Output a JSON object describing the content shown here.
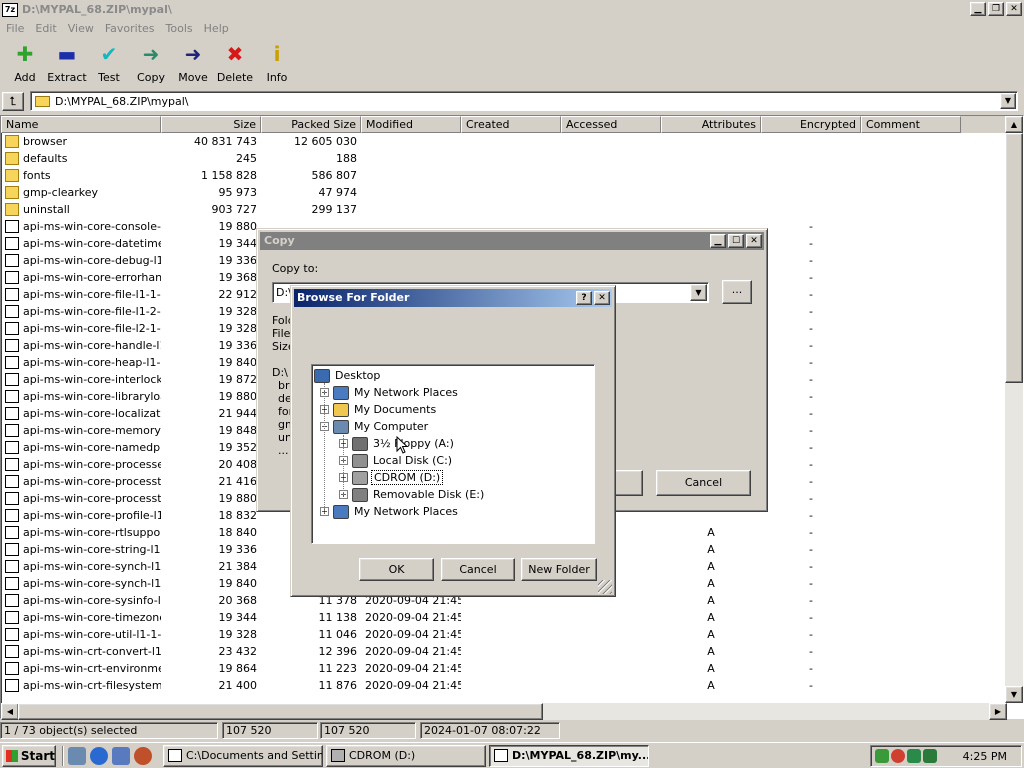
{
  "window": {
    "title": "D:\\MYPAL_68.ZIP\\mypal\\"
  },
  "menu": [
    "File",
    "Edit",
    "View",
    "Favorites",
    "Tools",
    "Help"
  ],
  "toolbar": [
    {
      "label": "Add",
      "icon": "add-icon",
      "glyph": "✚",
      "color": "#2ea42e"
    },
    {
      "label": "Extract",
      "icon": "extract-icon",
      "glyph": "▬",
      "color": "#1c2fa8"
    },
    {
      "label": "Test",
      "icon": "test-icon",
      "glyph": "✔",
      "color": "#16b6c0"
    },
    {
      "label": "Copy",
      "icon": "copy-icon",
      "glyph": "➜",
      "color": "#2a8a6a"
    },
    {
      "label": "Move",
      "icon": "move-icon",
      "glyph": "➜",
      "color": "#1c2480"
    },
    {
      "label": "Delete",
      "icon": "delete-icon",
      "glyph": "✖",
      "color": "#d81818"
    },
    {
      "label": "Info",
      "icon": "info-icon",
      "glyph": "i",
      "color": "#c8a000"
    }
  ],
  "address": {
    "path": "D:\\MYPAL_68.ZIP\\mypal\\"
  },
  "columns": [
    "Name",
    "Size",
    "Packed Size",
    "Modified",
    "Created",
    "Accessed",
    "Attributes",
    "Encrypted",
    "Comment"
  ],
  "rows": [
    {
      "type": "folder",
      "name": "browser",
      "size": "40 831 743",
      "packed": "12 605 030",
      "modified": "",
      "attr": "",
      "enc": ""
    },
    {
      "type": "folder",
      "name": "defaults",
      "size": "245",
      "packed": "188",
      "modified": "",
      "attr": "",
      "enc": ""
    },
    {
      "type": "folder",
      "name": "fonts",
      "size": "1 158 828",
      "packed": "586 807",
      "modified": "",
      "attr": "",
      "enc": ""
    },
    {
      "type": "folder",
      "name": "gmp-clearkey",
      "size": "95 973",
      "packed": "47 974",
      "modified": "",
      "attr": "",
      "enc": ""
    },
    {
      "type": "folder",
      "name": "uninstall",
      "size": "903 727",
      "packed": "299 137",
      "modified": "",
      "attr": "",
      "enc": ""
    },
    {
      "type": "file",
      "name": "api-ms-win-core-console-l...",
      "size": "19 880",
      "packed": "",
      "modified": "",
      "attr": "",
      "enc": "-"
    },
    {
      "type": "file",
      "name": "api-ms-win-core-datetime-...",
      "size": "19 344",
      "packed": "",
      "modified": "",
      "attr": "",
      "enc": "-"
    },
    {
      "type": "file",
      "name": "api-ms-win-core-debug-l1-...",
      "size": "19 336",
      "packed": "",
      "modified": "",
      "attr": "",
      "enc": "-"
    },
    {
      "type": "file",
      "name": "api-ms-win-core-errorhan...",
      "size": "19 368",
      "packed": "",
      "modified": "",
      "attr": "",
      "enc": "-"
    },
    {
      "type": "file",
      "name": "api-ms-win-core-file-l1-1-0...",
      "size": "22 912",
      "packed": "",
      "modified": "",
      "attr": "",
      "enc": "-"
    },
    {
      "type": "file",
      "name": "api-ms-win-core-file-l1-2-0...",
      "size": "19 328",
      "packed": "",
      "modified": "",
      "attr": "",
      "enc": "-"
    },
    {
      "type": "file",
      "name": "api-ms-win-core-file-l2-1-0...",
      "size": "19 328",
      "packed": "",
      "modified": "",
      "attr": "",
      "enc": "-"
    },
    {
      "type": "file",
      "name": "api-ms-win-core-handle-l1...",
      "size": "19 336",
      "packed": "",
      "modified": "",
      "attr": "",
      "enc": "-"
    },
    {
      "type": "file",
      "name": "api-ms-win-core-heap-l1-1...",
      "size": "19 840",
      "packed": "",
      "modified": "",
      "attr": "",
      "enc": "-"
    },
    {
      "type": "file",
      "name": "api-ms-win-core-interlocke...",
      "size": "19 872",
      "packed": "",
      "modified": "",
      "attr": "",
      "enc": "-"
    },
    {
      "type": "file",
      "name": "api-ms-win-core-libraryloa...",
      "size": "19 880",
      "packed": "",
      "modified": "",
      "attr": "",
      "enc": "-"
    },
    {
      "type": "file",
      "name": "api-ms-win-core-localizatio...",
      "size": "21 944",
      "packed": "",
      "modified": "",
      "attr": "",
      "enc": "-"
    },
    {
      "type": "file",
      "name": "api-ms-win-core-memory-l...",
      "size": "19 848",
      "packed": "",
      "modified": "",
      "attr": "",
      "enc": "-"
    },
    {
      "type": "file",
      "name": "api-ms-win-core-namedpip...",
      "size": "19 352",
      "packed": "",
      "modified": "",
      "attr": "",
      "enc": "-"
    },
    {
      "type": "file",
      "name": "api-ms-win-core-processe...",
      "size": "20 408",
      "packed": "",
      "modified": "",
      "attr": "",
      "enc": "-"
    },
    {
      "type": "file",
      "name": "api-ms-win-core-processt...",
      "size": "21 416",
      "packed": "",
      "modified": "",
      "attr": "",
      "enc": "-"
    },
    {
      "type": "file",
      "name": "api-ms-win-core-processt...",
      "size": "19 880",
      "packed": "",
      "modified": "",
      "attr": "",
      "enc": "-"
    },
    {
      "type": "file",
      "name": "api-ms-win-core-profile-l1-...",
      "size": "18 832",
      "packed": "",
      "modified": "",
      "attr": "",
      "enc": "-"
    },
    {
      "type": "file",
      "name": "api-ms-win-core-rtlsuppor...",
      "size": "18 840",
      "packed": "",
      "modified": "",
      "attr": "A",
      "enc": "-"
    },
    {
      "type": "file",
      "name": "api-ms-win-core-string-l1-...",
      "size": "19 336",
      "packed": "",
      "modified": "",
      "attr": "A",
      "enc": "-"
    },
    {
      "type": "file",
      "name": "api-ms-win-core-synch-l1-...",
      "size": "21 384",
      "packed": "",
      "modified": "",
      "attr": "A",
      "enc": "-"
    },
    {
      "type": "file",
      "name": "api-ms-win-core-synch-l1-...",
      "size": "19 840",
      "packed": "",
      "modified": "",
      "attr": "A",
      "enc": "-"
    },
    {
      "type": "file",
      "name": "api-ms-win-core-sysinfo-l1...",
      "size": "20 368",
      "packed": "11 378",
      "modified": "2020-09-04 21:45",
      "attr": "A",
      "enc": "-"
    },
    {
      "type": "file",
      "name": "api-ms-win-core-timezone...",
      "size": "19 344",
      "packed": "11 138",
      "modified": "2020-09-04 21:45",
      "attr": "A",
      "enc": "-"
    },
    {
      "type": "file",
      "name": "api-ms-win-core-util-l1-1-0...",
      "size": "19 328",
      "packed": "11 046",
      "modified": "2020-09-04 21:45",
      "attr": "A",
      "enc": "-"
    },
    {
      "type": "file",
      "name": "api-ms-win-crt-convert-l1-...",
      "size": "23 432",
      "packed": "12 396",
      "modified": "2020-09-04 21:45",
      "attr": "A",
      "enc": "-"
    },
    {
      "type": "file",
      "name": "api-ms-win-crt-environme...",
      "size": "19 864",
      "packed": "11 223",
      "modified": "2020-09-04 21:45",
      "attr": "A",
      "enc": "-"
    },
    {
      "type": "file",
      "name": "api-ms-win-crt-filesystem-l...",
      "size": "21 400",
      "packed": "11 876",
      "modified": "2020-09-04 21:45",
      "attr": "A",
      "enc": "-"
    }
  ],
  "status": {
    "selected": "1 / 73 object(s) selected",
    "size": "107 520",
    "packed": "107 520",
    "modified": "2024-01-07 08:07:22"
  },
  "copy_dialog": {
    "title": "Copy",
    "copy_to_label": "Copy to:",
    "path_value": "D:\\",
    "browse_label": "...",
    "info_labels": [
      "Fold",
      "Files",
      "Size"
    ],
    "path_text": "D:\\",
    "item_list": [
      "bro",
      "de",
      "for",
      "gm",
      "un",
      "..."
    ],
    "cancel_label": "Cancel"
  },
  "browse_dialog": {
    "title": "Browse For Folder",
    "ok_label": "OK",
    "cancel_label": "Cancel",
    "new_folder_label": "New Folder",
    "tree": [
      {
        "label": "Desktop",
        "level": 0,
        "expander": "",
        "icon": "desktop-icon",
        "selected": false
      },
      {
        "label": "My Network Places",
        "level": 1,
        "expander": "+",
        "icon": "network-places-icon",
        "selected": false
      },
      {
        "label": "My Documents",
        "level": 1,
        "expander": "+",
        "icon": "my-documents-icon",
        "selected": false
      },
      {
        "label": "My Computer",
        "level": 1,
        "expander": "−",
        "icon": "my-computer-icon",
        "selected": false
      },
      {
        "label": "3½ Floppy (A:)",
        "level": 2,
        "expander": "+",
        "icon": "floppy-drive-icon",
        "selected": false
      },
      {
        "label": "Local Disk (C:)",
        "level": 2,
        "expander": "+",
        "icon": "hard-disk-icon",
        "selected": false
      },
      {
        "label": "CDROM (D:)",
        "level": 2,
        "expander": "+",
        "icon": "cdrom-drive-icon",
        "selected": true
      },
      {
        "label": "Removable Disk (E:)",
        "level": 2,
        "expander": "+",
        "icon": "removable-disk-icon",
        "selected": false
      },
      {
        "label": "My Network Places",
        "level": 1,
        "expander": "+",
        "icon": "network-places-icon",
        "selected": false
      }
    ]
  },
  "taskbar": {
    "start_label": "Start",
    "tasks": [
      {
        "label": "C:\\Documents and Settin...",
        "active": false
      },
      {
        "label": "CDROM (D:)",
        "active": false
      },
      {
        "label": "D:\\MYPAL_68.ZIP\\my...",
        "active": true
      }
    ],
    "clock": "4:25 PM"
  }
}
